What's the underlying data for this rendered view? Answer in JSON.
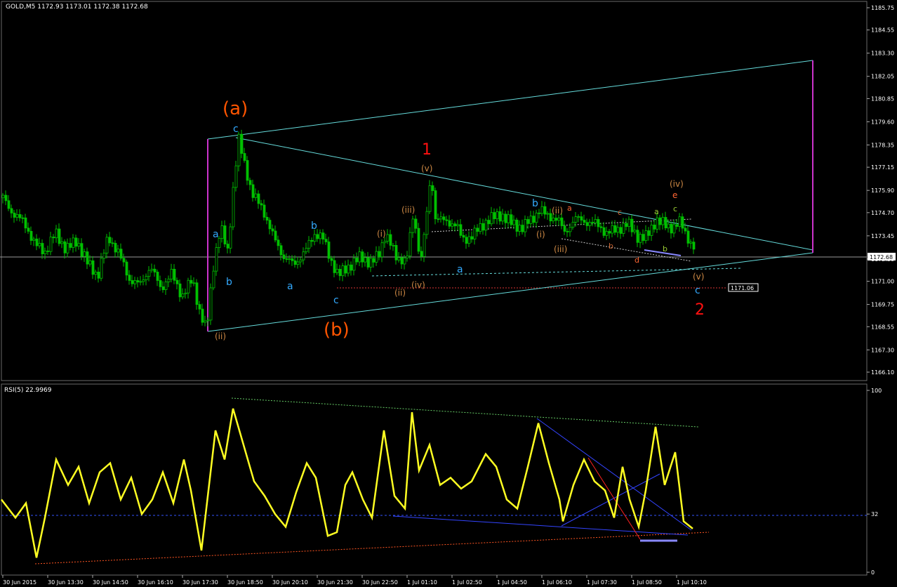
{
  "main_header": "GOLD,M5  1172.93 1173.01 1172.38 1172.68",
  "rsi_header": "RSI(5) 22.9969",
  "price_box": "1172.68",
  "level_box": "1171.06",
  "colors": {
    "candle": "#00c000",
    "cyan": "#66dddd",
    "magenta": "#cc33cc",
    "orange": "#ff5500",
    "red": "#ff1010",
    "blue": "#33aaff",
    "tan": "#cc8844",
    "rsi": "#ffff22",
    "grid": "#404040"
  },
  "chart_data": [
    {
      "type": "candlestick",
      "symbol": "GOLD",
      "timeframe": "M5",
      "ohlc_last": {
        "open": 1172.93,
        "high": 1173.01,
        "low": 1172.38,
        "close": 1172.68
      },
      "ylim": [
        1166.1,
        1186.3
      ],
      "yticks": [
        "1185.75",
        "1184.55",
        "1183.30",
        "1182.05",
        "1180.85",
        "1179.60",
        "1178.35",
        "1177.15",
        "1175.90",
        "1174.70",
        "1173.45",
        "1172.20",
        "1171.00",
        "1169.75",
        "1168.55",
        "1167.30",
        "1166.10"
      ],
      "xticks": [
        "30 Jun 2015",
        "30 Jun 13:30",
        "30 Jun 14:50",
        "30 Jun 16:10",
        "30 Jun 17:30",
        "30 Jun 18:50",
        "30 Jun 20:10",
        "30 Jun 21:30",
        "30 Jun 22:50",
        "1 Jul 01:10",
        "1 Jul 02:50",
        "1 Jul 04:50",
        "1 Jul 06:10",
        "1 Jul 07:30",
        "1 Jul 08:50",
        "1 Jul 10:10"
      ],
      "close_path": [
        [
          0,
          1175.5
        ],
        [
          15,
          1174.6
        ],
        [
          30,
          1174.2
        ],
        [
          45,
          1173.0
        ],
        [
          60,
          1172.6
        ],
        [
          75,
          1173.6
        ],
        [
          90,
          1172.7
        ],
        [
          105,
          1173.2
        ],
        [
          120,
          1172.0
        ],
        [
          135,
          1171.3
        ],
        [
          150,
          1173.4
        ],
        [
          165,
          1172.5
        ],
        [
          180,
          1171.1
        ],
        [
          195,
          1170.8
        ],
        [
          210,
          1171.8
        ],
        [
          225,
          1170.6
        ],
        [
          240,
          1171.4
        ],
        [
          255,
          1170.2
        ],
        [
          270,
          1171.1
        ],
        [
          280,
          1169.4
        ],
        [
          290,
          1168.3
        ],
        [
          300,
          1171.9
        ],
        [
          310,
          1173.9
        ],
        [
          320,
          1172.6
        ],
        [
          330,
          1176.8
        ],
        [
          336,
          1178.6
        ],
        [
          345,
          1177.2
        ],
        [
          355,
          1175.7
        ],
        [
          370,
          1174.9
        ],
        [
          385,
          1173.4
        ],
        [
          400,
          1172.3
        ],
        [
          415,
          1171.9
        ],
        [
          430,
          1172.6
        ],
        [
          445,
          1173.6
        ],
        [
          455,
          1173.4
        ],
        [
          465,
          1172.3
        ],
        [
          478,
          1171.3
        ],
        [
          495,
          1171.9
        ],
        [
          510,
          1172.3
        ],
        [
          525,
          1172.0
        ],
        [
          535,
          1172.4
        ],
        [
          545,
          1173.6
        ],
        [
          560,
          1172.3
        ],
        [
          575,
          1172.1
        ],
        [
          585,
          1174.7
        ],
        [
          595,
          1172.0
        ],
        [
          605,
          1174.9
        ],
        [
          610,
          1177.0
        ],
        [
          615,
          1174.5
        ],
        [
          630,
          1174.2
        ],
        [
          645,
          1174.1
        ],
        [
          655,
          1173.2
        ],
        [
          670,
          1173.5
        ],
        [
          690,
          1174.3
        ],
        [
          710,
          1174.6
        ],
        [
          725,
          1174.1
        ],
        [
          740,
          1173.9
        ],
        [
          755,
          1174.4
        ],
        [
          765,
          1174.9
        ],
        [
          775,
          1174.5
        ],
        [
          790,
          1174.4
        ],
        [
          800,
          1173.6
        ],
        [
          815,
          1174.4
        ],
        [
          830,
          1174.2
        ],
        [
          845,
          1174.1
        ],
        [
          860,
          1173.6
        ],
        [
          875,
          1173.8
        ],
        [
          890,
          1174.1
        ],
        [
          905,
          1173.4
        ],
        [
          915,
          1173.3
        ],
        [
          930,
          1174.3
        ],
        [
          945,
          1174.0
        ],
        [
          955,
          1173.9
        ],
        [
          965,
          1174.2
        ],
        [
          975,
          1173.4
        ],
        [
          985,
          1172.7
        ]
      ],
      "annotations": [
        "(a)",
        "(b)",
        "1",
        "2",
        "a",
        "b",
        "c",
        "(i)",
        "(ii)",
        "(iii)",
        "(iv)",
        "(v)",
        "d",
        "e"
      ]
    },
    {
      "type": "line",
      "name": "RSI(5)",
      "current": 22.9969,
      "ylim": [
        0,
        100
      ],
      "yticks": [
        "100",
        "32",
        "0"
      ],
      "level": 32,
      "values": [
        [
          0,
          40
        ],
        [
          10,
          35
        ],
        [
          20,
          30
        ],
        [
          35,
          38
        ],
        [
          50,
          8
        ],
        [
          62,
          30
        ],
        [
          78,
          62
        ],
        [
          95,
          48
        ],
        [
          110,
          58
        ],
        [
          125,
          38
        ],
        [
          140,
          55
        ],
        [
          155,
          60
        ],
        [
          170,
          40
        ],
        [
          185,
          52
        ],
        [
          200,
          32
        ],
        [
          215,
          40
        ],
        [
          230,
          55
        ],
        [
          245,
          38
        ],
        [
          260,
          62
        ],
        [
          270,
          45
        ],
        [
          285,
          12
        ],
        [
          298,
          55
        ],
        [
          305,
          78
        ],
        [
          318,
          62
        ],
        [
          330,
          90
        ],
        [
          345,
          70
        ],
        [
          360,
          50
        ],
        [
          375,
          42
        ],
        [
          390,
          32
        ],
        [
          405,
          25
        ],
        [
          420,
          44
        ],
        [
          435,
          60
        ],
        [
          448,
          52
        ],
        [
          465,
          20
        ],
        [
          478,
          22
        ],
        [
          490,
          48
        ],
        [
          500,
          55
        ],
        [
          515,
          40
        ],
        [
          528,
          30
        ],
        [
          545,
          78
        ],
        [
          560,
          42
        ],
        [
          575,
          35
        ],
        [
          585,
          88
        ],
        [
          595,
          56
        ],
        [
          610,
          70
        ],
        [
          625,
          48
        ],
        [
          640,
          52
        ],
        [
          655,
          46
        ],
        [
          670,
          50
        ],
        [
          690,
          65
        ],
        [
          705,
          58
        ],
        [
          720,
          40
        ],
        [
          735,
          35
        ],
        [
          750,
          58
        ],
        [
          765,
          82
        ],
        [
          780,
          60
        ],
        [
          795,
          40
        ],
        [
          800,
          28
        ],
        [
          815,
          48
        ],
        [
          830,
          62
        ],
        [
          845,
          50
        ],
        [
          860,
          45
        ],
        [
          873,
          30
        ],
        [
          885,
          58
        ],
        [
          895,
          40
        ],
        [
          908,
          25
        ],
        [
          918,
          45
        ],
        [
          932,
          80
        ],
        [
          945,
          48
        ],
        [
          960,
          66
        ],
        [
          972,
          28
        ],
        [
          985,
          24
        ]
      ]
    }
  ]
}
